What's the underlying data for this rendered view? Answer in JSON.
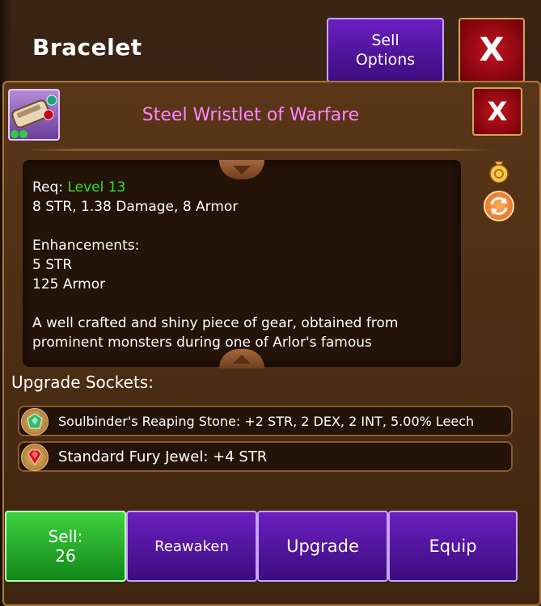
{
  "window": {
    "title": "Bracelet",
    "sell_options_label_1": "Sell",
    "sell_options_label_2": "Options",
    "close_label": "X"
  },
  "item": {
    "name": "Steel Wristlet of Warfare",
    "close_label": "X",
    "req_prefix": "Req:",
    "req_level": "Level 13",
    "stats": "8 STR, 1.38 Damage, 8 Armor",
    "enhancements_title": "Enhancements:",
    "enhancements": [
      "5 STR",
      "125 Armor"
    ],
    "description": "A well crafted and shiny piece of gear, obtained from prominent monsters during one of Arlor's famous"
  },
  "sockets": {
    "label": "Upgrade Sockets:",
    "items": [
      {
        "text": "Soulbinder's Reaping Stone: +2 STR, 2 DEX, 2 INT, 5.00% Leech",
        "gem": "green-gem-icon"
      },
      {
        "text": "Standard Fury Jewel: +4 STR",
        "gem": "red-gem-icon"
      }
    ]
  },
  "actions": {
    "sell_label": "Sell:",
    "sell_price": "26",
    "reawaken": "Reawaken",
    "upgrade": "Upgrade",
    "equip": "Equip"
  },
  "colors": {
    "title_pink": "#ff86ff",
    "level_green": "#2de22d",
    "purple_button": "#5a18a8",
    "green_button": "#2cb82c",
    "close_red": "#b0101a"
  }
}
